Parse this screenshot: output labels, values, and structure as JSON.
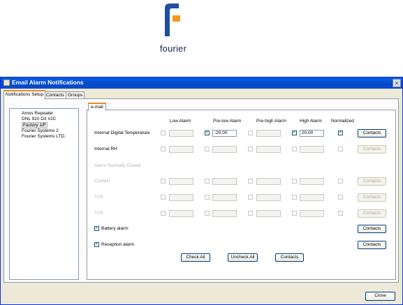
{
  "logo": {
    "text": "fourier",
    "colors": {
      "primary": "#1e4fa0",
      "accent": "#f39a22"
    }
  },
  "window": {
    "title": "Email Alarm Notifications",
    "close_glyph": "×"
  },
  "tabs": [
    "Notifications Setup",
    "Contacts",
    "Groups"
  ],
  "devices": [
    "Amos Repeater",
    "DNL 910 D3 #2C",
    "Factory 1/F",
    "Fourier Systems 2",
    "Fourier Systems LTD."
  ],
  "inner_tab": "e-mail",
  "columns": [
    "Low Alarm",
    "Pre-low Alarm",
    "Pre-high Alarm",
    "High Alarm",
    "Normalized"
  ],
  "rows": [
    {
      "label": "Internal Digital Temperature",
      "prelow_value": "-20.00",
      "high_value": "20.00",
      "contacts": "Contacts"
    },
    {
      "label": "Internal RH",
      "contacts": "Contacts"
    },
    {
      "label": "Alarm Normally Closed"
    },
    {
      "label": "Contact",
      "contacts": "Contacts"
    },
    {
      "label": "TCK",
      "contacts": "Contacts"
    },
    {
      "label": "TCK",
      "contacts": "Contacts"
    }
  ],
  "battery_alarm": {
    "label": "Battery alarm",
    "contacts": "Contacts"
  },
  "reception_alarm": {
    "label": "Reception alarm",
    "contacts": "Contacts"
  },
  "bottom_buttons": {
    "check_all": "Check All",
    "uncheck_all": "Uncheck All",
    "contacts": "Contacts"
  },
  "close_button": "Close"
}
